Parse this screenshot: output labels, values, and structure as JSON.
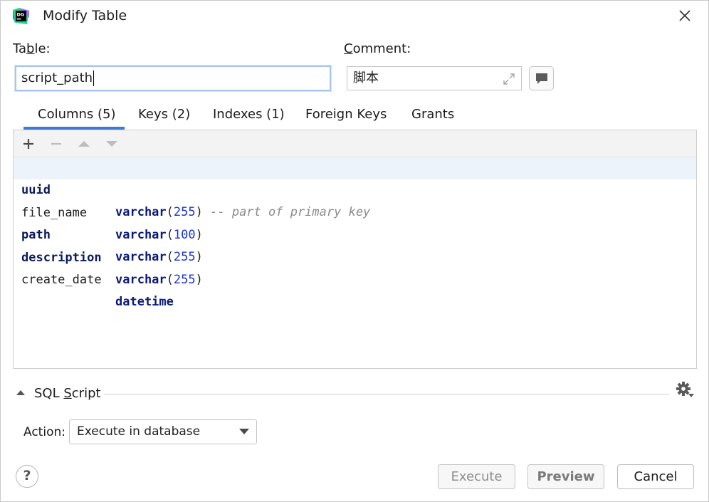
{
  "window": {
    "title": "Modify Table",
    "app_icon_text": "DG"
  },
  "table_field": {
    "label_pre": "Ta",
    "label_u": "b",
    "label_post": "le:",
    "value": "script_path"
  },
  "comment_field": {
    "label_u": "C",
    "label_post": "omment:",
    "value": "脚本"
  },
  "tabs": [
    {
      "label": "Columns (5)",
      "active": true
    },
    {
      "label": "Keys (2)"
    },
    {
      "label": "Indexes (1)"
    },
    {
      "label": "Foreign Keys"
    },
    {
      "label": "Grants"
    }
  ],
  "columns": [
    {
      "name": "uuid",
      "type": "varchar",
      "open": "(",
      "size": "255",
      "close": ")",
      "comment": "-- part of primary key"
    },
    {
      "name": "file_name",
      "type": "varchar",
      "open": "(",
      "size": "100",
      "close": ")"
    },
    {
      "name": "path",
      "type": "varchar",
      "open": "(",
      "size": "255",
      "close": ")"
    },
    {
      "name": "description",
      "type": "varchar",
      "open": "(",
      "size": "255",
      "close": ")"
    },
    {
      "name": "create_date",
      "type": "datetime"
    }
  ],
  "sql_script": {
    "label_pre": "SQL ",
    "label_u": "S",
    "label_post": "cript"
  },
  "action": {
    "label": "Action:",
    "selected": "Execute in database"
  },
  "buttons": {
    "help": "?",
    "execute": "Execute",
    "preview": "Preview",
    "cancel": "Cancel"
  },
  "colors": {
    "accent": "#3d78d8",
    "selected_row": "#edf3fb",
    "keyword": "#0b1a7a",
    "number": "#1a33d6"
  }
}
